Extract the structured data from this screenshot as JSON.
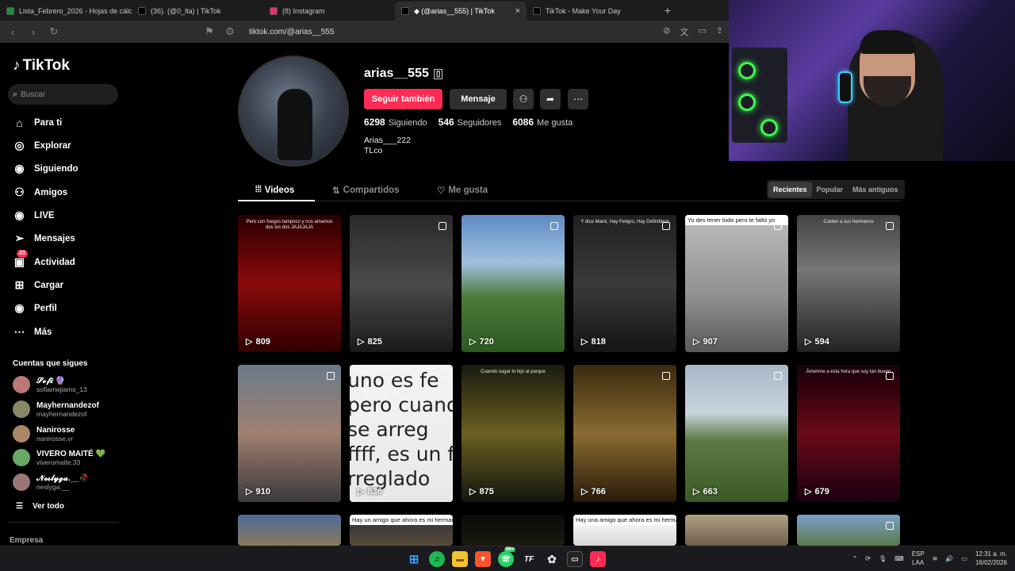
{
  "browser": {
    "tabs": [
      {
        "title": "Lista_Febrero_2026 - Hojas de cálcul",
        "color": "#1e8e3e"
      },
      {
        "title": "(36). (@0_lta) | TikTok",
        "color": "#000000"
      },
      {
        "title": "(8) Instagram",
        "color": "#e1306c"
      },
      {
        "title": "◆ (@arias__555) | TikTok",
        "color": "#000000",
        "active": true
      },
      {
        "title": "TikTok - Make Your Day",
        "color": "#000000"
      }
    ],
    "url": "tiktok.com/@arias__555"
  },
  "sidebar": {
    "logo": "TikTok",
    "search_placeholder": "Buscar",
    "items": [
      {
        "label": "Para ti",
        "icon": "home-icon"
      },
      {
        "label": "Explorar",
        "icon": "compass-icon"
      },
      {
        "label": "Siguiendo",
        "icon": "following-avatar-icon"
      },
      {
        "label": "Amigos",
        "icon": "friends-icon"
      },
      {
        "label": "LIVE",
        "icon": "live-icon"
      },
      {
        "label": "Mensajes",
        "icon": "send-icon"
      },
      {
        "label": "Actividad",
        "icon": "activity-icon",
        "badge": "23"
      },
      {
        "label": "Cargar",
        "icon": "upload-icon"
      },
      {
        "label": "Perfil",
        "icon": "profile-icon"
      },
      {
        "label": "Más",
        "icon": "more-icon"
      }
    ],
    "following_title": "Cuentas que sigues",
    "following": [
      {
        "name": "𝓢𝓸𝓯𝓲 🔮",
        "handle": "sofiamejiams_13",
        "color": "#b77"
      },
      {
        "name": "Mayhernandezof",
        "handle": "mayhernandezof",
        "color": "#886"
      },
      {
        "name": "Nanirosse",
        "handle": "nanirosse.vr",
        "color": "#a86"
      },
      {
        "name": "VIVERO MAITÉ 💚",
        "handle": "viveromaite.33",
        "color": "#6a6"
      },
      {
        "name": "𝓝𝓮𝓼𝓵𝔂𝓰𝓪.__🥀",
        "handle": "neslyga.__",
        "color": "#977"
      }
    ],
    "see_all": "Ver todo",
    "company": "Empresa"
  },
  "profile": {
    "username": "arias__555",
    "follow_button": "Seguir también",
    "message_button": "Mensaje",
    "stats": [
      {
        "value": "6298",
        "label": "Siguiendo"
      },
      {
        "value": "546",
        "label": "Seguidores"
      },
      {
        "value": "6086",
        "label": "Me gusta"
      }
    ],
    "bio_line1": "Arias___222",
    "bio_line2": "TLco"
  },
  "tabs": {
    "videos": "Videos",
    "shared": "Compartidos",
    "liked": "Me gusta",
    "sort": [
      "Recientes",
      "Popular",
      "Más antiguos"
    ]
  },
  "videos": [
    {
      "views": "809",
      "bg": "linear-gradient(180deg,#2a0000 0%,#8a0a0a 50%,#300000 100%)",
      "pin": false,
      "caption": "Pero con fuegos tampoco y nos amamos dos los dos JAJAJAJA"
    },
    {
      "views": "825",
      "bg": "linear-gradient(180deg,#2a2a2a 0%,#4a4a4a 50%,#1a1a1a 100%)",
      "pin": true,
      "caption": ""
    },
    {
      "views": "720",
      "bg": "linear-gradient(180deg,#5e8bc4 0%,#9fc0e0 35%,#4b7a3a 60%,#2e5a1e 100%)",
      "pin": true,
      "caption": ""
    },
    {
      "views": "818",
      "bg": "linear-gradient(180deg,#202020 0%,#3a3a3a 50%,#151515 100%)",
      "pin": true,
      "caption": "Y dice Mami, Hay Peligro, Hay Definiblem"
    },
    {
      "views": "907",
      "bg": "linear-gradient(180deg,#bdbdbd 0%,#8f8f8f 60%,#5a5a5a 100%)",
      "pin": true,
      "caption": "",
      "top": "Yo des tener todo pero te faltó yo"
    },
    {
      "views": "594",
      "bg": "linear-gradient(180deg,#444 0%,#777 40%,#222 100%)",
      "pin": true,
      "caption": "Cuiden a sus hermanos"
    },
    {
      "views": "910",
      "bg": "linear-gradient(180deg,#6a7a8a 0%,#a08070 50%,#3a3a3a 100%)",
      "pin": true,
      "caption": ""
    },
    {
      "views": "836",
      "bg": "linear-gradient(180deg,#f4f4f4 0%,#e8e8e8 100%)",
      "pin": false,
      "caption": "",
      "bigtext": [
        "uno es fe",
        "pero cuand",
        "se arreg",
        "ffff, es un fe",
        "rreglado"
      ]
    },
    {
      "views": "875",
      "bg": "linear-gradient(180deg,#1a1a10 0%,#6a6020 50%,#151510 100%)",
      "pin": false,
      "caption": "Cuando sugar lo hijo al parque"
    },
    {
      "views": "766",
      "bg": "linear-gradient(180deg,#3a2a10 0%,#8a6a30 50%,#2a1a0a 100%)",
      "pin": true,
      "caption": ""
    },
    {
      "views": "663",
      "bg": "linear-gradient(180deg,#a8b8c8 0%,#c8d4dc 35%,#5c7a44 55%,#3a5a24 100%)",
      "pin": true,
      "caption": ""
    },
    {
      "views": "679",
      "bg": "linear-gradient(180deg,#150008 0%,#6a0a18 50%,#1a0010 100%)",
      "pin": true,
      "caption": "Ámenme a esta hora que soy tan bueno"
    },
    {
      "views": "",
      "bg": "linear-gradient(180deg,#4a6a9a 0%,#8a7a5a 100%)",
      "pin": false,
      "caption": ""
    },
    {
      "views": "",
      "bg": "linear-gradient(180deg,#303040 0%,#5a4a3a 100%)",
      "pin": false,
      "caption": "",
      "top": "Hay un amigo que ahora es mi hermano"
    },
    {
      "views": "",
      "bg": "linear-gradient(180deg,#0a0a0a 0%,#1a1a10 100%)",
      "pin": false,
      "caption": ""
    },
    {
      "views": "",
      "bg": "linear-gradient(180deg,#ffffff 0%,#d8d8d8 100%)",
      "pin": false,
      "caption": "",
      "top": "Hay una amigo que ahora es mi hermano"
    },
    {
      "views": "",
      "bg": "linear-gradient(180deg,#b0a080 0%,#706050 100%)",
      "pin": false,
      "caption": ""
    },
    {
      "views": "",
      "bg": "linear-gradient(180deg,#7aa0c8 0%,#5a7a4a 100%)",
      "pin": true,
      "caption": ""
    }
  ],
  "taskbar": {
    "lang": "ESP",
    "lang2": "LAA",
    "time": "12:31 a. m.",
    "date": "16/02/2026",
    "whatsapp_badge": "99+"
  }
}
